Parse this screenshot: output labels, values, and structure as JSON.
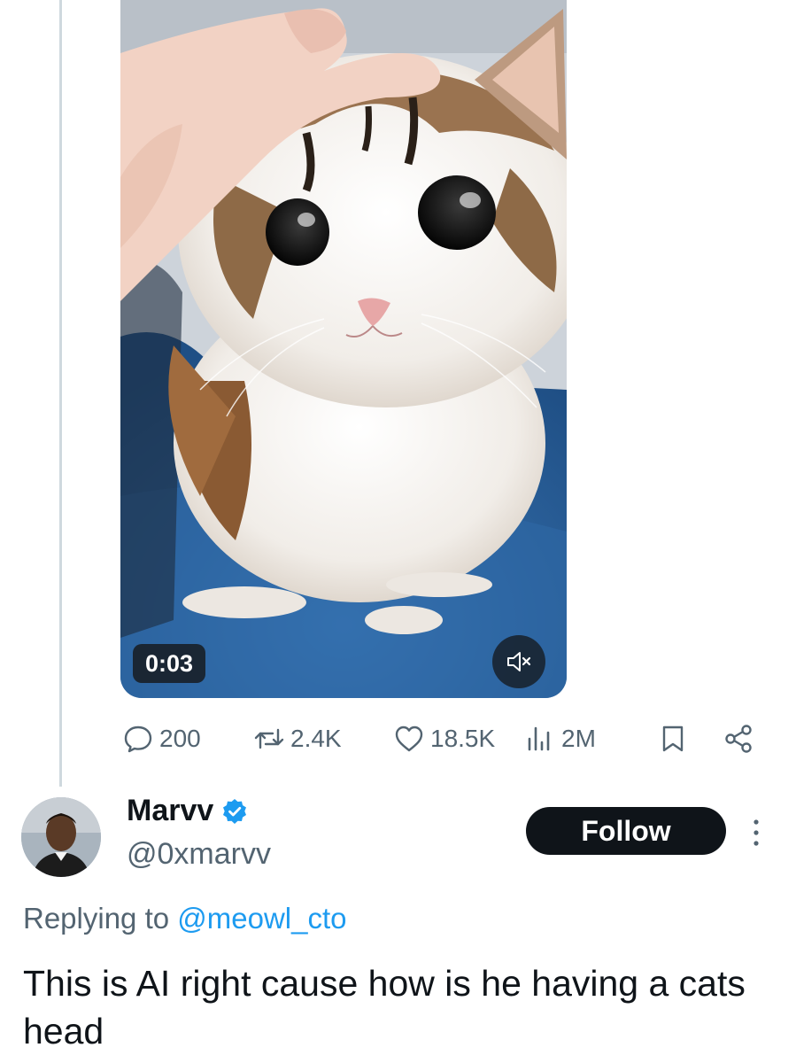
{
  "video": {
    "timestamp": "0:03",
    "mute_icon": "speaker-muted-icon"
  },
  "actions": {
    "replies": "200",
    "reposts": "2.4K",
    "likes": "18.5K",
    "views": "2M"
  },
  "reply": {
    "display_name": "Marvv",
    "handle": "@0xmarvv",
    "follow_label": "Follow",
    "replying_prefix": "Replying to",
    "replying_to": "@meowl_cto",
    "text": "This is AI right cause how is he having a cats head"
  },
  "colors": {
    "verified": "#1d9bf0",
    "mention": "#1d9bf0",
    "secondary_text": "#536471",
    "follow_bg": "#0f1419"
  }
}
